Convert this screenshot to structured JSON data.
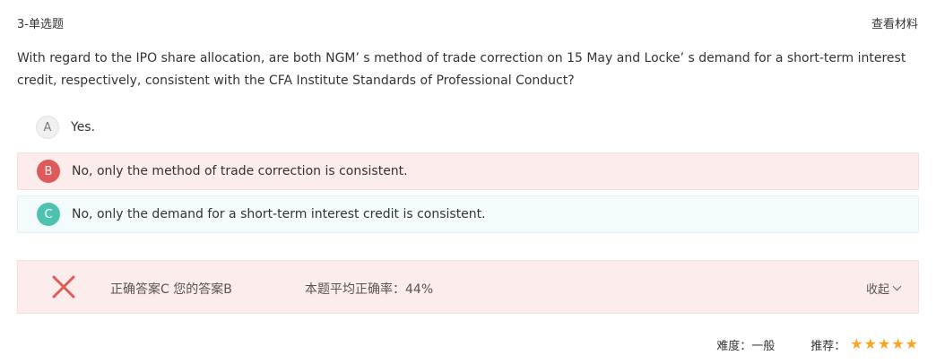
{
  "header": {
    "question_type": "3-单选题",
    "material_link": "查看材料"
  },
  "question": {
    "text": "With regard to the IPO share allocation, are both NGM’ s method of trade correction on 15 May and Locke’ s demand for a short-term interest credit, respectively, consistent with the CFA Institute Standards of Professional Conduct?"
  },
  "options": [
    {
      "letter": "A",
      "text": "Yes.",
      "state": "unselected"
    },
    {
      "letter": "B",
      "text": "No, only the method of trade correction is consistent.",
      "state": "selected-wrong"
    },
    {
      "letter": "C",
      "text": "No, only the demand for a short-term interest credit is consistent.",
      "state": "correct"
    }
  ],
  "result": {
    "icon": "x-icon",
    "answer_summary": "正确答案C 您的答案B",
    "average_rate": "本题平均正确率：44%",
    "collapse_label": "收起"
  },
  "footer": {
    "difficulty": "难度：一般",
    "recommend_label": "推荐：",
    "recommend_stars": 5
  },
  "colors": {
    "wrong": "#e05a5a",
    "correct": "#4ec2b1",
    "star": "#f5a623",
    "wrong_bg": "#fdecec"
  }
}
